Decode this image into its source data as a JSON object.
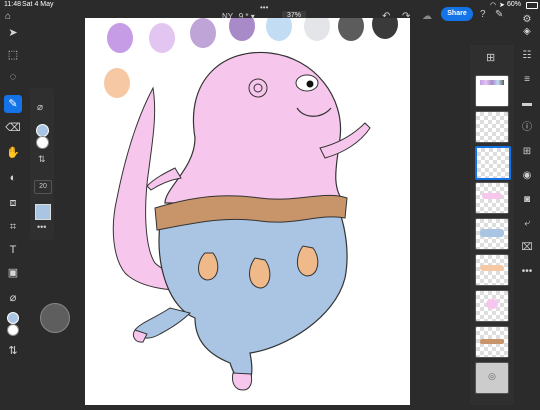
{
  "status_bar": {
    "time": "11:48",
    "date": "Sat 4 May",
    "battery": "60%"
  },
  "top_bar": {
    "doc_title": "NY...9 *",
    "zoom": "37%",
    "share_label": "Share",
    "more_dots": "•••"
  },
  "colors": {
    "accent": "#1473e6",
    "canvas": "#ffffff",
    "body_pink": "#f6c6ec",
    "trousers_blue": "#a9c5e3",
    "belt_brown": "#c8946a"
  },
  "swatches": [
    "#c79ce6",
    "#e3c5f1",
    "#bfa4d8",
    "#a98ac9",
    "#c2dcf3",
    "#e3e5e9",
    "#5c5c5c",
    "#3a3a3a",
    "#f6c9a4"
  ],
  "brush_size": "20",
  "left_tools": [
    "select-arrow",
    "transform",
    "lasso",
    "brush",
    "eraser",
    "smudge",
    "dodge",
    "fill",
    "crop",
    "text",
    "image-place",
    "eyedropper"
  ],
  "right_rail": [
    "layers",
    "adjust",
    "properties",
    "comments",
    "info",
    "add-layer",
    "visibility",
    "mask",
    "merge",
    "settings",
    "more"
  ]
}
